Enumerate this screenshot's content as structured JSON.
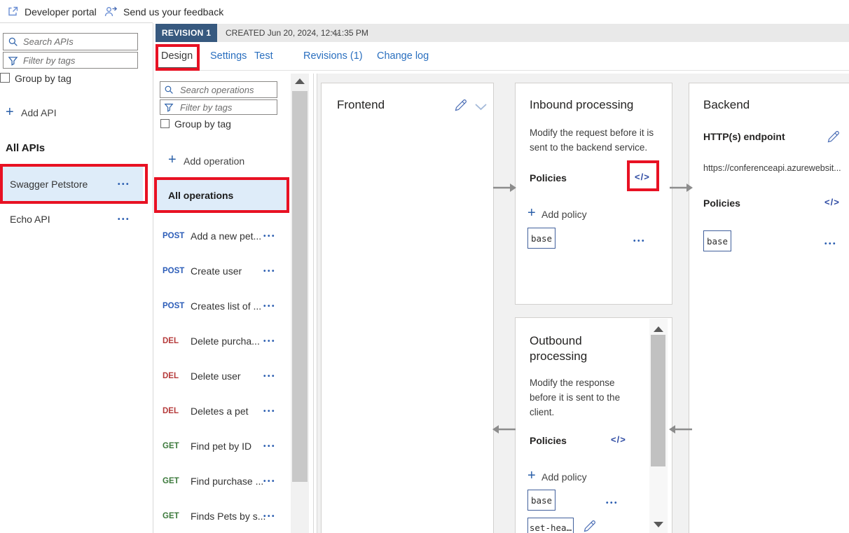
{
  "topbar": {
    "developer_portal_label": "Developer portal",
    "feedback_label": "Send us your feedback"
  },
  "revision_bar": {
    "badge": "REVISION 1",
    "created": "CREATED Jun 20, 2024, 12:41:35 PM"
  },
  "tabs": {
    "design": "Design",
    "settings": "Settings",
    "test": "Test",
    "revisions": "Revisions (1)",
    "change_log": "Change log"
  },
  "sidebar": {
    "search_placeholder": "Search APIs",
    "filter_placeholder": "Filter by tags",
    "group_by_tag_label": "Group by tag",
    "add_api_label": "Add API",
    "all_apis_heading": "All APIs",
    "apis": [
      {
        "name": "Swagger Petstore"
      },
      {
        "name": "Echo API"
      }
    ]
  },
  "operations": {
    "search_placeholder": "Search operations",
    "filter_placeholder": "Filter by tags",
    "group_by_tag_label": "Group by tag",
    "add_operation_label": "Add operation",
    "all_operations_label": "All operations",
    "items": [
      {
        "method": "POST",
        "name": "Add a new pet..."
      },
      {
        "method": "POST",
        "name": "Create user"
      },
      {
        "method": "POST",
        "name": "Creates list of ..."
      },
      {
        "method": "DEL",
        "name": "Delete purcha..."
      },
      {
        "method": "DEL",
        "name": "Delete user"
      },
      {
        "method": "DEL",
        "name": "Deletes a pet"
      },
      {
        "method": "GET",
        "name": "Find pet by ID"
      },
      {
        "method": "GET",
        "name": "Find purchase ..."
      },
      {
        "method": "GET",
        "name": "Finds Pets by s..."
      }
    ]
  },
  "panels": {
    "frontend": {
      "title": "Frontend"
    },
    "inbound": {
      "title": "Inbound processing",
      "description": "Modify the request before it is sent to the backend service.",
      "policies_label": "Policies",
      "add_policy_label": "Add policy",
      "policies": [
        {
          "name": "base"
        }
      ]
    },
    "backend": {
      "title": "Backend",
      "endpoint_label": "HTTP(s) endpoint",
      "endpoint_url": "https://conferenceapi.azurewebsit...",
      "policies_label": "Policies",
      "policies": [
        {
          "name": "base"
        }
      ]
    },
    "outbound": {
      "title": "Outbound processing",
      "description": "Modify the response before it is sent to the client.",
      "policies_label": "Policies",
      "add_policy_label": "Add policy",
      "policies": [
        {
          "name": "base"
        },
        {
          "name": "set-hea…"
        }
      ]
    }
  },
  "icons": {
    "code_glyph": "</>",
    "more_glyph": "•••",
    "plus_glyph": "+"
  },
  "colors": {
    "accent_blue": "#2a6fbf",
    "badge_blue": "#37597f",
    "highlight_row": "#deecf9",
    "annotation_red": "#e81123",
    "method_post": "#2b5cb8",
    "method_del": "#b63c3c",
    "method_get": "#3d7a3d"
  }
}
